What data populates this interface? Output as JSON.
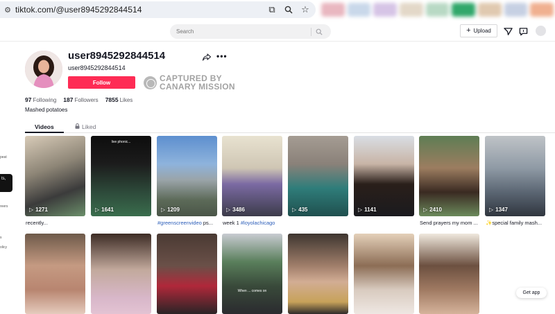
{
  "browser": {
    "url": "tiktok.com/@user8945292844514"
  },
  "header": {
    "search_placeholder": "Search",
    "upload_label": "Upload"
  },
  "sidebar": {
    "fragments": [
      "peat",
      "ts,",
      "reers",
      "s",
      "olicy"
    ]
  },
  "profile": {
    "username": "user8945292844514",
    "handle": "user8945292844514",
    "follow_label": "Follow",
    "watermark_line1": "CAPTURED BY",
    "watermark_line2": "CANARY MISSION",
    "following_count": "97",
    "following_label": "Following",
    "followers_count": "187",
    "followers_label": "Followers",
    "likes_count": "7855",
    "likes_label": "Likes",
    "bio": "Mashed potatoes"
  },
  "tabs": {
    "videos": "Videos",
    "liked": "Liked"
  },
  "videos_row1": [
    {
      "views": "1271",
      "caption": "recently..."
    },
    {
      "views": "1641",
      "caption": "",
      "overlay_text": "live phonic..."
    },
    {
      "views": "1209",
      "caption_tag": "#greenscreenvideo",
      "caption_after": " ps..."
    },
    {
      "views": "3486",
      "caption": "week 1 ",
      "caption_tag": "#loyolachicago"
    },
    {
      "views": "435",
      "caption": ""
    },
    {
      "views": "1141",
      "caption": ""
    },
    {
      "views": "2410",
      "caption": "Send prayers my mom ..."
    },
    {
      "views": "1347",
      "caption": "✨special family mash..."
    }
  ],
  "videos_row2": [
    {
      "overlay_text": ""
    },
    {
      "overlay_text": ""
    },
    {
      "overlay_text": ""
    },
    {
      "overlay_text": "When ... comes on"
    },
    {
      "overlay_text": ""
    },
    {
      "overlay_text": ""
    },
    {
      "overlay_text": ""
    }
  ],
  "get_app_label": "Get app",
  "colors": {
    "follow_button": "#fe2c55",
    "link": "#2b5db9"
  }
}
